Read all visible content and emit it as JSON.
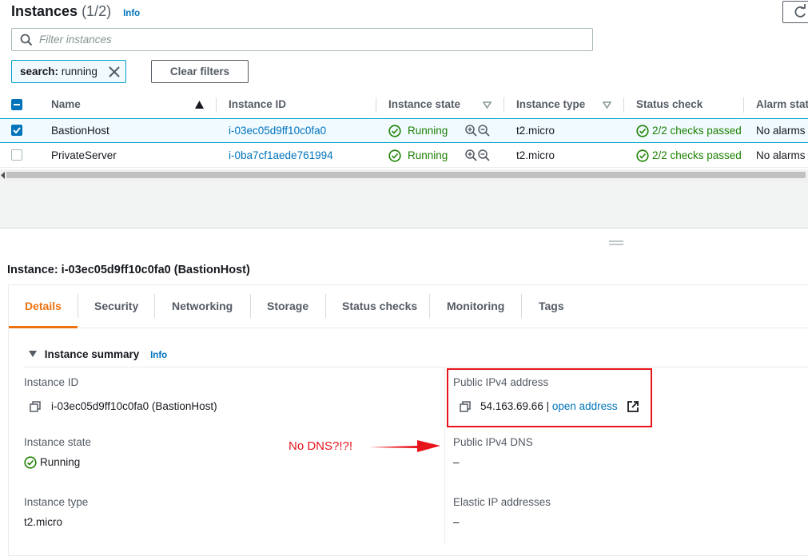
{
  "header": {
    "title": "Instances",
    "count": "(1/2)",
    "info": "Info"
  },
  "filter": {
    "placeholder": "Filter instances",
    "token": {
      "key": "search:",
      "value": "running"
    },
    "clear_label": "Clear filters"
  },
  "table": {
    "columns": [
      "Name",
      "Instance ID",
      "Instance state",
      "Instance type",
      "Status check",
      "Alarm stat"
    ],
    "rows": [
      {
        "selected": true,
        "name": "BastionHost",
        "id": "i-03ec05d9ff10c0fa0",
        "state": "Running",
        "type": "t2.micro",
        "status": "2/2 checks passed",
        "alarm": "No alarms"
      },
      {
        "selected": false,
        "name": "PrivateServer",
        "id": "i-0ba7cf1aede761994",
        "state": "Running",
        "type": "t2.micro",
        "status": "2/2 checks passed",
        "alarm": "No alarms"
      }
    ]
  },
  "detail": {
    "title": "Instance: i-03ec05d9ff10c0fa0 (BastionHost)",
    "tabs": [
      "Details",
      "Security",
      "Networking",
      "Storage",
      "Status checks",
      "Monitoring",
      "Tags"
    ],
    "active_tab": "Details",
    "summary_title": "Instance summary",
    "summary_info": "Info",
    "left": [
      {
        "label": "Instance ID",
        "value": "i-03ec05d9ff10c0fa0 (BastionHost)"
      },
      {
        "label": "Instance state",
        "value": "Running"
      },
      {
        "label": "Instance type",
        "value": "t2.micro"
      }
    ],
    "right": [
      {
        "label": "Public IPv4 address",
        "value": "54.163.69.66",
        "sep": "|",
        "link": "open address"
      },
      {
        "label": "Public IPv4 DNS",
        "value": "–"
      },
      {
        "label": "Elastic IP addresses",
        "value": "–"
      }
    ]
  },
  "annotation": {
    "text": "No DNS?!?!",
    "color": "#e8141b"
  },
  "colors": {
    "accent": "#ec7211",
    "link": "#0073bb",
    "success": "#1d8102",
    "selection": "#f1faff"
  },
  "icons": [
    "refresh-icon",
    "search-icon",
    "close-icon",
    "sort-up-icon",
    "sort-down-icon",
    "check-circle-icon",
    "zoom-in-icon",
    "zoom-out-icon",
    "copy-icon",
    "external-link-icon",
    "caret-down-icon",
    "drag-handle-icon",
    "arrow-icon"
  ]
}
